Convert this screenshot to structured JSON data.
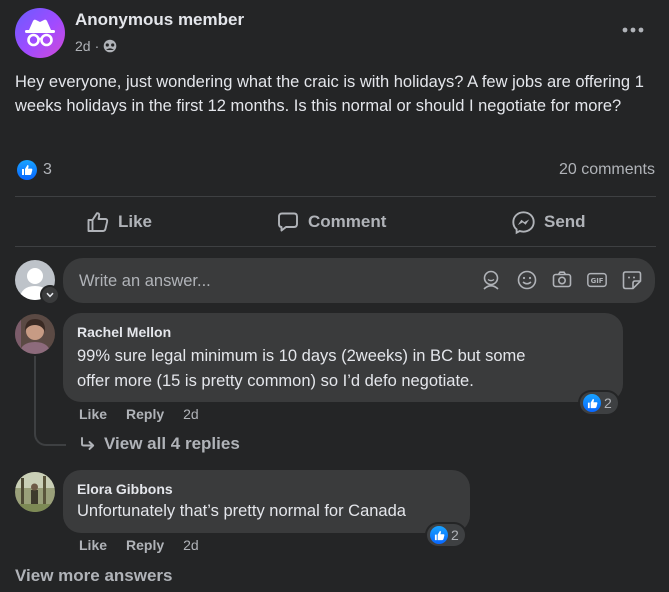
{
  "post": {
    "author": "Anonymous member",
    "time": "2d",
    "separator": "·",
    "text": "Hey everyone, just wondering what the craic is with holidays? A few jobs are offering 1 weeks holidays in the first 12 months. Is this normal or should I negotiate for more?",
    "reaction_count": "3",
    "comments_count": "20 comments"
  },
  "actions": {
    "like": "Like",
    "comment": "Comment",
    "send": "Send"
  },
  "composer": {
    "placeholder": "Write an answer..."
  },
  "comments": [
    {
      "name": "Rachel Mellon",
      "text_line1": "99% sure legal minimum is 10 days (2weeks) in BC but some",
      "text_line2": "offer more (15 is pretty common) so I’d defo negotiate.",
      "like": "Like",
      "reply": "Reply",
      "time": "2d",
      "reactions": "2",
      "view_replies": "View all 4 replies"
    },
    {
      "name": "Elora Gibbons",
      "text_line1": "Unfortunately that’s pretty normal for Canada",
      "like": "Like",
      "reply": "Reply",
      "time": "2d",
      "reactions": "2"
    }
  ],
  "footer": {
    "view_more": "View more answers"
  },
  "colors": {
    "background": "#242526",
    "bubble": "#3a3b3c",
    "like_blue": "#0866ff",
    "text": "#e4e6eb",
    "muted": "#b0b3b8"
  }
}
